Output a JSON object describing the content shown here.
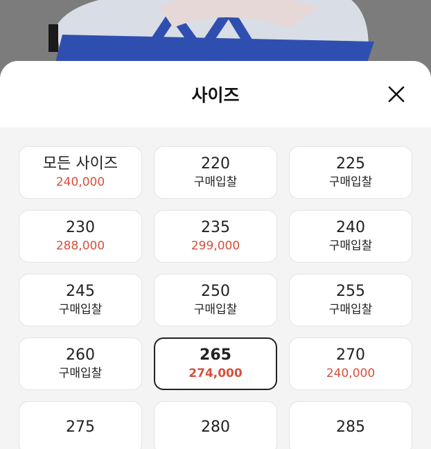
{
  "sheet": {
    "title": "사이즈"
  },
  "sizes": [
    {
      "size": "모든 사이즈",
      "sub": "240,000",
      "is_price": true
    },
    {
      "size": "220",
      "sub": "구매입찰",
      "is_price": false
    },
    {
      "size": "225",
      "sub": "구매입찰",
      "is_price": false
    },
    {
      "size": "230",
      "sub": "288,000",
      "is_price": true
    },
    {
      "size": "235",
      "sub": "299,000",
      "is_price": true
    },
    {
      "size": "240",
      "sub": "구매입찰",
      "is_price": false
    },
    {
      "size": "245",
      "sub": "구매입찰",
      "is_price": false
    },
    {
      "size": "250",
      "sub": "구매입찰",
      "is_price": false
    },
    {
      "size": "255",
      "sub": "구매입찰",
      "is_price": false
    },
    {
      "size": "260",
      "sub": "구매입찰",
      "is_price": false
    },
    {
      "size": "265",
      "sub": "274,000",
      "is_price": true,
      "selected": true
    },
    {
      "size": "270",
      "sub": "240,000",
      "is_price": true
    },
    {
      "size": "275",
      "sub": "",
      "is_price": false
    },
    {
      "size": "280",
      "sub": "",
      "is_price": false
    },
    {
      "size": "285",
      "sub": "",
      "is_price": false
    }
  ],
  "colors": {
    "price": "#d6503c",
    "selected_border": "#222222",
    "shoe_accent": "#2f4fb0"
  },
  "icons": {
    "close": "close-icon"
  }
}
